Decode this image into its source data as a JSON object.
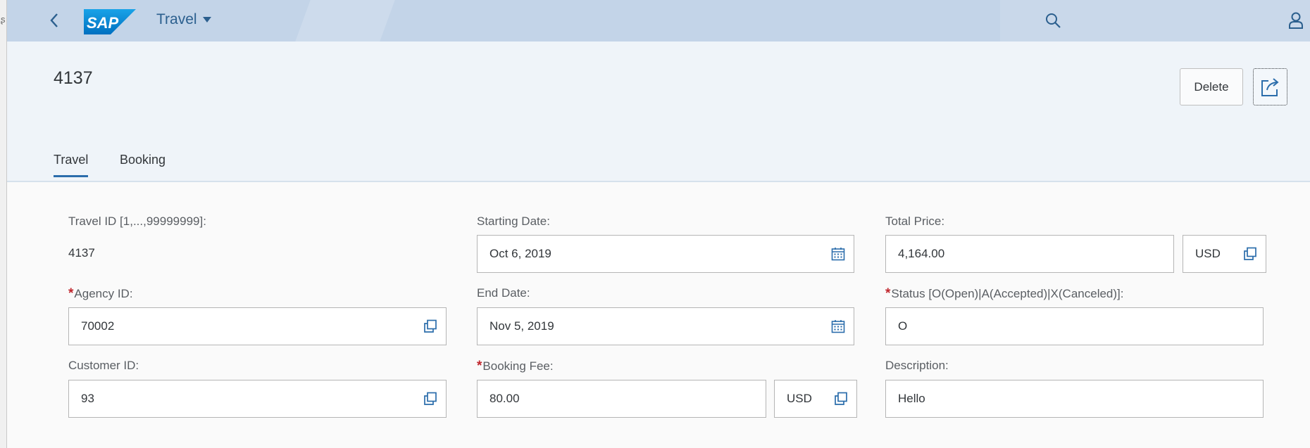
{
  "shell": {
    "app_title": "Travel"
  },
  "header": {
    "object_title": "4137",
    "delete_label": "Delete",
    "tabs": [
      {
        "label": "Travel"
      },
      {
        "label": "Booking"
      }
    ]
  },
  "form": {
    "travel_id": {
      "label": "Travel ID [1,...,99999999]:",
      "value": "4137"
    },
    "agency_id": {
      "label": "Agency ID:",
      "value": "70002",
      "required": true
    },
    "customer_id": {
      "label": "Customer ID:",
      "value": "93"
    },
    "starting_date": {
      "label": "Starting Date:",
      "value": "Oct 6, 2019"
    },
    "end_date": {
      "label": "End Date:",
      "value": "Nov 5, 2019"
    },
    "booking_fee": {
      "label": "Booking Fee:",
      "value": "80.00",
      "currency": "USD",
      "required": true
    },
    "total_price": {
      "label": "Total Price:",
      "value": "4,164.00",
      "currency": "USD"
    },
    "status": {
      "label": "Status [O(Open)|A(Accepted)|X(Canceled)]:",
      "value": "O",
      "required": true
    },
    "description": {
      "label": "Description:",
      "value": "Hello"
    }
  },
  "colors": {
    "shell_bg": "#c3d4e8",
    "header_bg": "#eff4f9",
    "accent": "#2b6dab",
    "required": "#c0262d"
  },
  "icons": [
    "back-icon",
    "sap-logo",
    "dropdown-caret-icon",
    "search-icon",
    "user-icon",
    "share-icon",
    "calendar-icon",
    "value-help-icon"
  ]
}
